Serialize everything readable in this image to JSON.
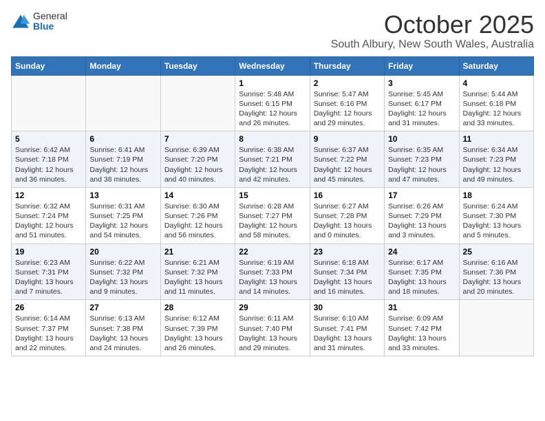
{
  "logo": {
    "text_general": "General",
    "text_blue": "Blue"
  },
  "title": "October 2025",
  "subtitle": "South Albury, New South Wales, Australia",
  "days_of_week": [
    "Sunday",
    "Monday",
    "Tuesday",
    "Wednesday",
    "Thursday",
    "Friday",
    "Saturday"
  ],
  "weeks": [
    [
      {
        "day": "",
        "info": ""
      },
      {
        "day": "",
        "info": ""
      },
      {
        "day": "",
        "info": ""
      },
      {
        "day": "1",
        "info": "Sunrise: 5:48 AM\nSunset: 6:15 PM\nDaylight: 12 hours\nand 26 minutes."
      },
      {
        "day": "2",
        "info": "Sunrise: 5:47 AM\nSunset: 6:16 PM\nDaylight: 12 hours\nand 29 minutes."
      },
      {
        "day": "3",
        "info": "Sunrise: 5:45 AM\nSunset: 6:17 PM\nDaylight: 12 hours\nand 31 minutes."
      },
      {
        "day": "4",
        "info": "Sunrise: 5:44 AM\nSunset: 6:18 PM\nDaylight: 12 hours\nand 33 minutes."
      }
    ],
    [
      {
        "day": "5",
        "info": "Sunrise: 6:42 AM\nSunset: 7:18 PM\nDaylight: 12 hours\nand 36 minutes."
      },
      {
        "day": "6",
        "info": "Sunrise: 6:41 AM\nSunset: 7:19 PM\nDaylight: 12 hours\nand 38 minutes."
      },
      {
        "day": "7",
        "info": "Sunrise: 6:39 AM\nSunset: 7:20 PM\nDaylight: 12 hours\nand 40 minutes."
      },
      {
        "day": "8",
        "info": "Sunrise: 6:38 AM\nSunset: 7:21 PM\nDaylight: 12 hours\nand 42 minutes."
      },
      {
        "day": "9",
        "info": "Sunrise: 6:37 AM\nSunset: 7:22 PM\nDaylight: 12 hours\nand 45 minutes."
      },
      {
        "day": "10",
        "info": "Sunrise: 6:35 AM\nSunset: 7:23 PM\nDaylight: 12 hours\nand 47 minutes."
      },
      {
        "day": "11",
        "info": "Sunrise: 6:34 AM\nSunset: 7:23 PM\nDaylight: 12 hours\nand 49 minutes."
      }
    ],
    [
      {
        "day": "12",
        "info": "Sunrise: 6:32 AM\nSunset: 7:24 PM\nDaylight: 12 hours\nand 51 minutes."
      },
      {
        "day": "13",
        "info": "Sunrise: 6:31 AM\nSunset: 7:25 PM\nDaylight: 12 hours\nand 54 minutes."
      },
      {
        "day": "14",
        "info": "Sunrise: 6:30 AM\nSunset: 7:26 PM\nDaylight: 12 hours\nand 56 minutes."
      },
      {
        "day": "15",
        "info": "Sunrise: 6:28 AM\nSunset: 7:27 PM\nDaylight: 12 hours\nand 58 minutes."
      },
      {
        "day": "16",
        "info": "Sunrise: 6:27 AM\nSunset: 7:28 PM\nDaylight: 13 hours\nand 0 minutes."
      },
      {
        "day": "17",
        "info": "Sunrise: 6:26 AM\nSunset: 7:29 PM\nDaylight: 13 hours\nand 3 minutes."
      },
      {
        "day": "18",
        "info": "Sunrise: 6:24 AM\nSunset: 7:30 PM\nDaylight: 13 hours\nand 5 minutes."
      }
    ],
    [
      {
        "day": "19",
        "info": "Sunrise: 6:23 AM\nSunset: 7:31 PM\nDaylight: 13 hours\nand 7 minutes."
      },
      {
        "day": "20",
        "info": "Sunrise: 6:22 AM\nSunset: 7:32 PM\nDaylight: 13 hours\nand 9 minutes."
      },
      {
        "day": "21",
        "info": "Sunrise: 6:21 AM\nSunset: 7:32 PM\nDaylight: 13 hours\nand 11 minutes."
      },
      {
        "day": "22",
        "info": "Sunrise: 6:19 AM\nSunset: 7:33 PM\nDaylight: 13 hours\nand 14 minutes."
      },
      {
        "day": "23",
        "info": "Sunrise: 6:18 AM\nSunset: 7:34 PM\nDaylight: 13 hours\nand 16 minutes."
      },
      {
        "day": "24",
        "info": "Sunrise: 6:17 AM\nSunset: 7:35 PM\nDaylight: 13 hours\nand 18 minutes."
      },
      {
        "day": "25",
        "info": "Sunrise: 6:16 AM\nSunset: 7:36 PM\nDaylight: 13 hours\nand 20 minutes."
      }
    ],
    [
      {
        "day": "26",
        "info": "Sunrise: 6:14 AM\nSunset: 7:37 PM\nDaylight: 13 hours\nand 22 minutes."
      },
      {
        "day": "27",
        "info": "Sunrise: 6:13 AM\nSunset: 7:38 PM\nDaylight: 13 hours\nand 24 minutes."
      },
      {
        "day": "28",
        "info": "Sunrise: 6:12 AM\nSunset: 7:39 PM\nDaylight: 13 hours\nand 26 minutes."
      },
      {
        "day": "29",
        "info": "Sunrise: 6:11 AM\nSunset: 7:40 PM\nDaylight: 13 hours\nand 29 minutes."
      },
      {
        "day": "30",
        "info": "Sunrise: 6:10 AM\nSunset: 7:41 PM\nDaylight: 13 hours\nand 31 minutes."
      },
      {
        "day": "31",
        "info": "Sunrise: 6:09 AM\nSunset: 7:42 PM\nDaylight: 13 hours\nand 33 minutes."
      },
      {
        "day": "",
        "info": ""
      }
    ]
  ]
}
